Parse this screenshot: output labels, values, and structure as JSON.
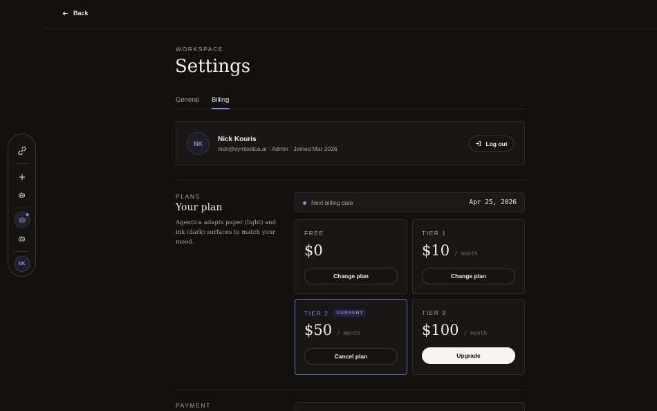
{
  "topbar": {
    "back_label": "Back"
  },
  "rail": {
    "avatar_initials": "NK",
    "icons": [
      "link-icon",
      "plus-icon",
      "robot-icon",
      "robot-icon",
      "robot-icon"
    ]
  },
  "page": {
    "eyebrow": "WORKSPACE",
    "title": "Settings",
    "tabs": [
      {
        "label": "General",
        "active": false
      },
      {
        "label": "Billing",
        "active": true
      }
    ]
  },
  "profile": {
    "initials": "NK",
    "name": "Nick Kouris",
    "meta": "nick@symbolica.ai · Admin · Joined Mar 2026",
    "logout_label": "Log out"
  },
  "plans": {
    "eyebrow": "PLANS",
    "title": "Your plan",
    "description": "Agentica adapts paper (light) and ink (dark) surfaces to match your mood.",
    "billing_label": "Next billing date",
    "billing_date": "Apr 25, 2026",
    "cards": [
      {
        "tier": "FREE",
        "amount": "$0",
        "per": "",
        "button": "Change plan",
        "current": false,
        "badge": ""
      },
      {
        "tier": "TIER 1",
        "amount": "$10",
        "per": "/ month",
        "button": "Change plan",
        "current": false,
        "badge": ""
      },
      {
        "tier": "TIER 2",
        "amount": "$50",
        "per": "/ month",
        "button": "Cancel plan",
        "current": true,
        "badge": "CURRENT"
      },
      {
        "tier": "TIER 3",
        "amount": "$100",
        "per": "/ month",
        "button": "Upgrade",
        "current": false,
        "badge": ""
      }
    ]
  },
  "payment": {
    "eyebrow": "PAYMENT"
  },
  "colors": {
    "accent": "#8a87e0",
    "background": "#121110"
  }
}
